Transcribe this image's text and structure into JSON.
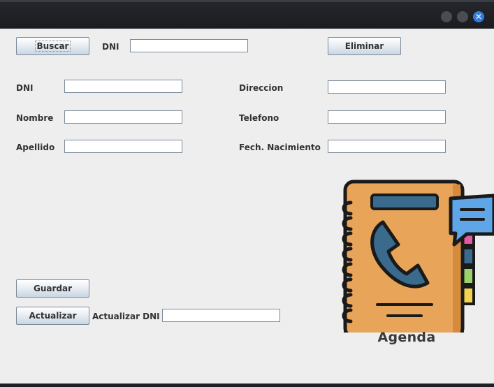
{
  "window": {
    "close_glyph": "✕"
  },
  "search": {
    "button_label": "Buscar",
    "dni_label": "DNI",
    "dni_value": ""
  },
  "delete": {
    "button_label": "Eliminar"
  },
  "form": {
    "dni_label": "DNI",
    "dni_value": "",
    "nombre_label": "Nombre",
    "nombre_value": "",
    "apellido_label": "Apellido",
    "apellido_value": "",
    "direccion_label": "Direccion",
    "direccion_value": "",
    "telefono_label": "Telefono",
    "telefono_value": "",
    "fecha_label": "Fech. Nacimiento",
    "fecha_value": ""
  },
  "actions": {
    "save_label": "Guardar",
    "update_label": "Actualizar",
    "update_dni_label": "Actualizar DNI",
    "update_dni_value": ""
  },
  "logo": {
    "text": "Agenda",
    "icon": "phone-book-icon",
    "colors": {
      "cover": "#e8a55a",
      "outline": "#1a1a1a",
      "phone": "#3a6a8c",
      "chat": "#5fa6e8"
    }
  }
}
